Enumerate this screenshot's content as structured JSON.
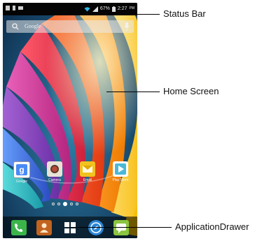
{
  "status_bar": {
    "battery": "67%",
    "time": "2:27"
  },
  "search": {
    "placeholder": "Google"
  },
  "home_apps": [
    {
      "label": "Google",
      "icon": "google-icon"
    },
    {
      "label": "Camera",
      "icon": "camera-icon"
    },
    {
      "label": "Email",
      "icon": "email-icon"
    },
    {
      "label": "Play Store",
      "icon": "play-store-icon"
    }
  ],
  "dock": [
    {
      "icon": "phone-icon",
      "color": "#3bb54a"
    },
    {
      "icon": "contacts-icon",
      "color": "#c2631f"
    },
    {
      "icon": "app-drawer-icon",
      "color": "#ffffff"
    },
    {
      "icon": "browser-icon",
      "color": "#2a86d6"
    },
    {
      "icon": "messaging-icon",
      "color": "#8ac53f"
    }
  ],
  "callouts": {
    "status_bar": "Status Bar",
    "home_screen": "Home Screen",
    "app_drawer": "ApplicationDrawer"
  }
}
